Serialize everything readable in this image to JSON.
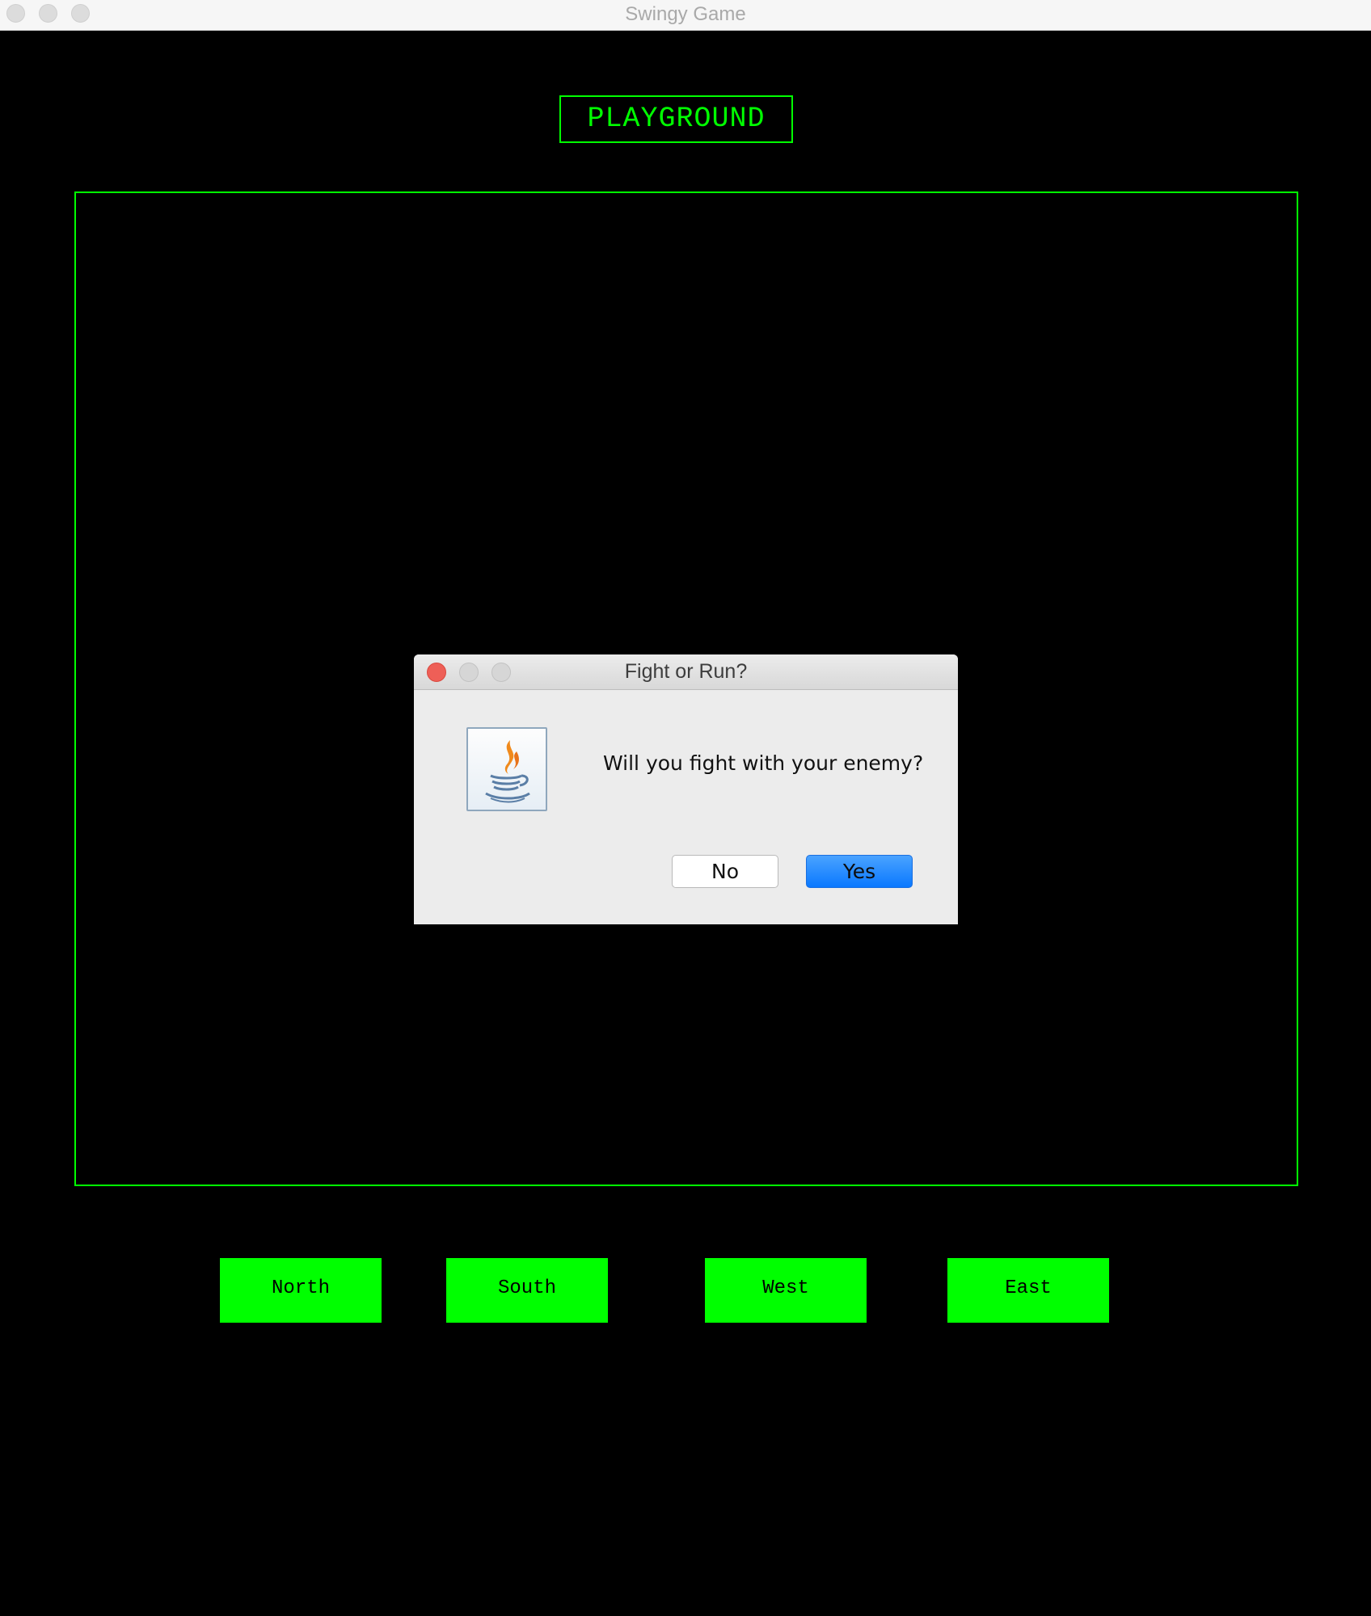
{
  "window": {
    "title": "Swingy Game"
  },
  "playground": {
    "title": "PLAYGROUND"
  },
  "controls": {
    "north": "North",
    "south": "South",
    "west": "West",
    "east": "East"
  },
  "dialog": {
    "title": "Fight or Run?",
    "message": "Will you fight with your enemy?",
    "no_label": "No",
    "yes_label": "Yes",
    "icon": "java-icon"
  },
  "colors": {
    "background": "#000000",
    "accent_green": "#00ff00",
    "dialog_bg": "#ececec",
    "primary_button": "#1a84ff",
    "close_red": "#ee5f57"
  }
}
